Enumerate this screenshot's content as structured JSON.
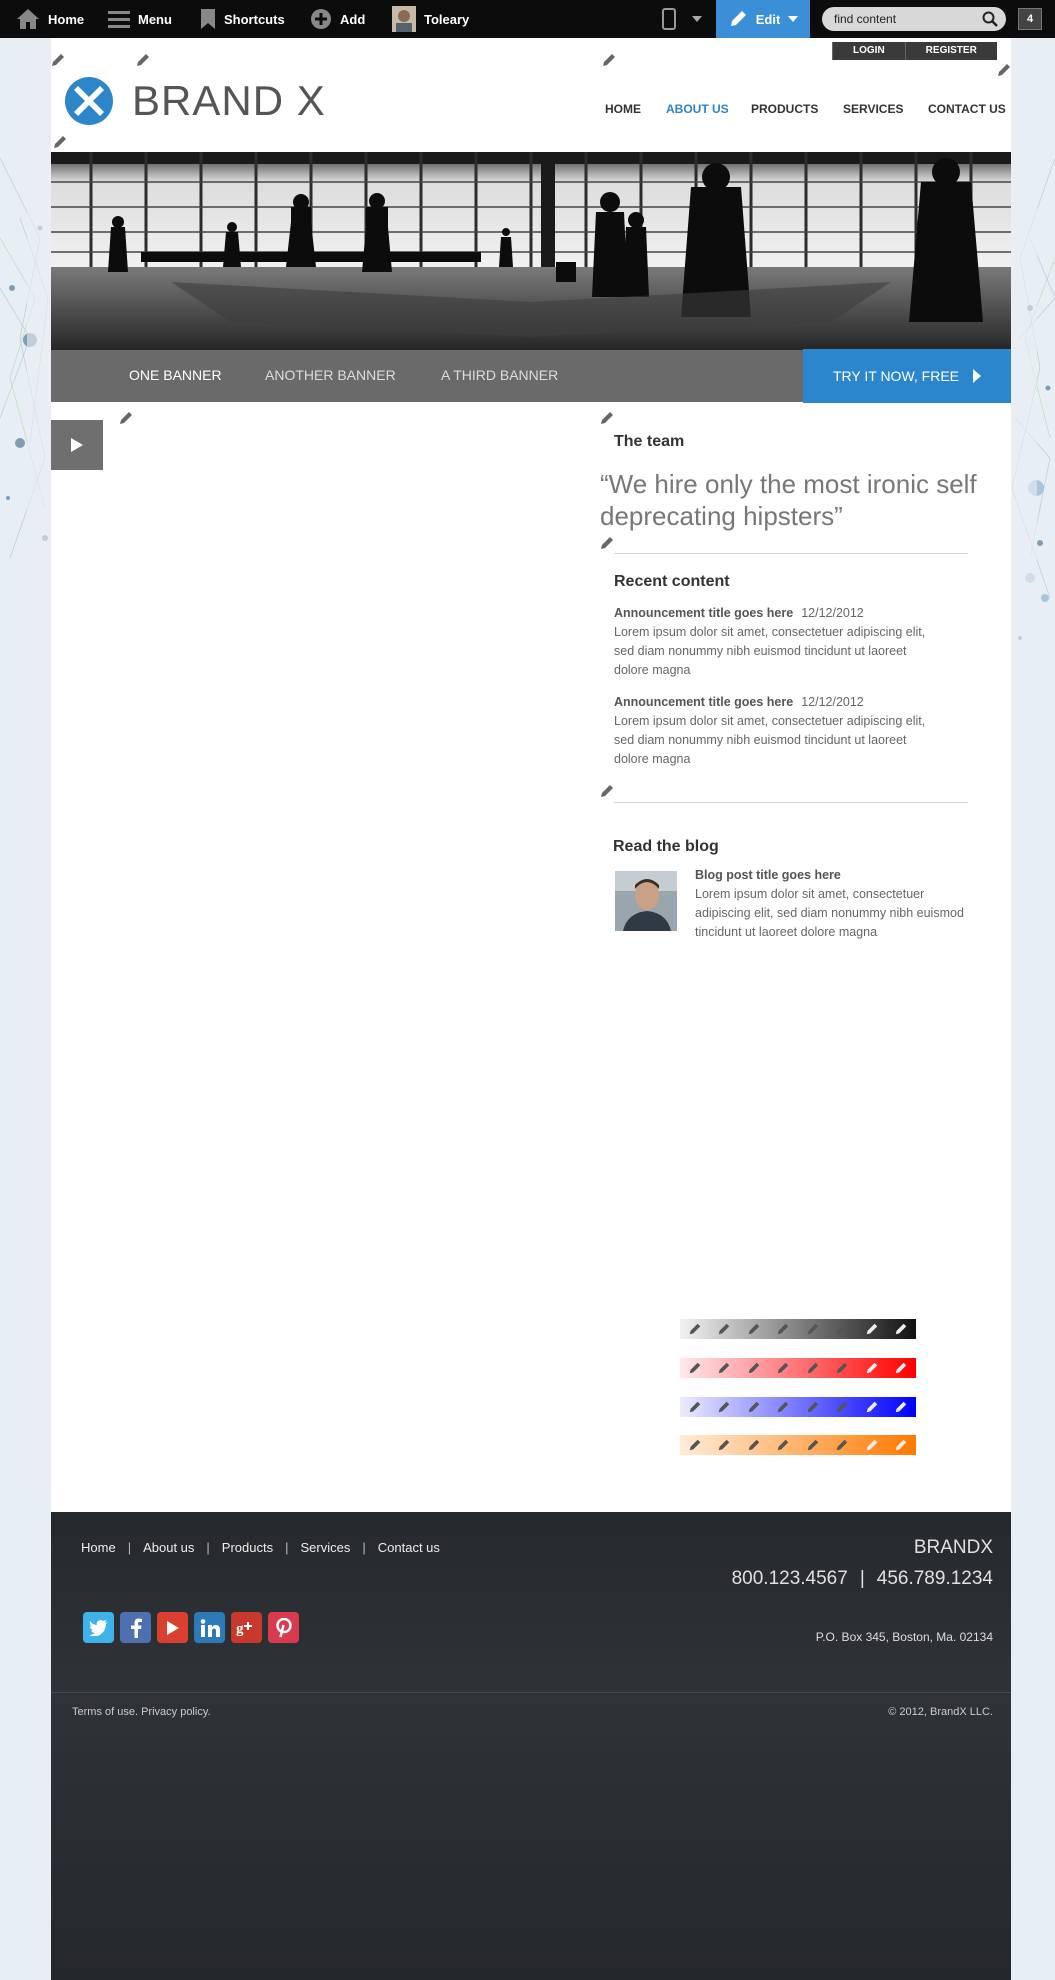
{
  "toolbar": {
    "home_label": "Home",
    "menu_label": "Menu",
    "shortcuts_label": "Shortcuts",
    "add_label": "Add",
    "user_label": "Toleary",
    "edit_label": "Edit",
    "search_value": "find content",
    "count_badge": "4",
    "accent_color": "#3a8fd6"
  },
  "header": {
    "login_label": "LOGIN",
    "register_label": "REGISTER",
    "logo_text": "BRAND X",
    "nav": [
      {
        "label": "HOME"
      },
      {
        "label": "ABOUT US",
        "active": true
      },
      {
        "label": "PRODUCTS"
      },
      {
        "label": "SERVICES"
      },
      {
        "label": "CONTACT US"
      }
    ]
  },
  "banner": {
    "tabs": [
      "ONE BANNER",
      "ANOTHER BANNER",
      "A THIRD BANNER"
    ],
    "selected_tab": "ONE BANNER",
    "cta_label": "TRY IT NOW, FREE",
    "cta_color": "#2b86ce"
  },
  "right_column": {
    "team_heading": "The team",
    "quote": "“We hire only the most ironic self deprecating hipsters”",
    "recent_heading": "Recent content",
    "announcements": [
      {
        "title": "Announcement title goes here",
        "date": "12/12/2012",
        "body": "Lorem ipsum dolor sit amet, consectetuer adipiscing elit, sed diam nonummy nibh euismod tincidunt ut laoreet dolore magna"
      },
      {
        "title": "Announcement title goes here",
        "date": "12/12/2012",
        "body": "Lorem ipsum dolor sit amet, consectetuer adipiscing elit, sed diam nonummy nibh euismod tincidunt ut laoreet dolore magna"
      }
    ],
    "blog_heading": "Read the blog",
    "blog_post": {
      "title": "Blog post title goes here",
      "body": "Lorem ipsum dolor sit amet, consectetuer adipiscing elit, sed diam nonummy nibh euismod tincidunt ut laoreet dolore magna"
    }
  },
  "pencil_palettes": [
    {
      "name": "gray",
      "from": "#f2f2f2",
      "to": "#111111"
    },
    {
      "name": "red",
      "from": "#ffe8ec",
      "to": "#ff0000"
    },
    {
      "name": "blue",
      "from": "#ececff",
      "to": "#0000ff"
    },
    {
      "name": "orange",
      "from": "#ffecd8",
      "to": "#ff7a00"
    }
  ],
  "footer": {
    "links": [
      "Home",
      "About us",
      "Products",
      "Services",
      "Contact us"
    ],
    "brand": "BRANDX",
    "phone_1": "800.123.4567",
    "phone_2": "456.789.1234",
    "address": "P.O. Box 345, Boston, Ma. 02134",
    "social": [
      "twitter-icon",
      "facebook-icon",
      "youtube-icon",
      "linkedin-icon",
      "google-plus-icon",
      "pinterest-icon"
    ],
    "terms": "Terms of use. Privacy policy.",
    "copyright": "© 2012, BrandX LLC."
  }
}
